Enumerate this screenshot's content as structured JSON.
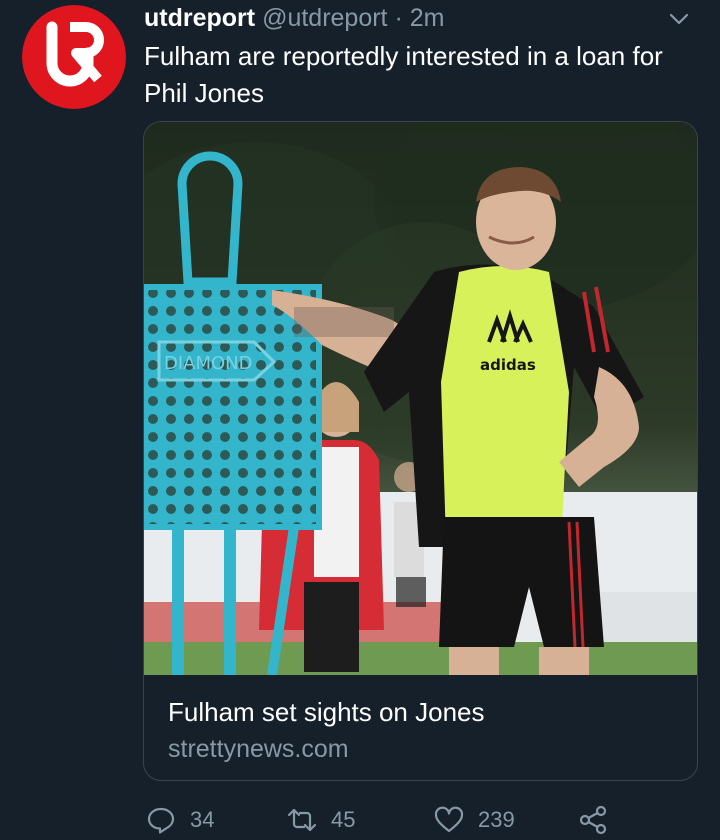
{
  "tweet": {
    "display_name": "utdreport",
    "handle": "@utdreport",
    "separator": "·",
    "time": "2m",
    "text": "Fulham are reportedly interested in a loan for Phil Jones",
    "avatar_icon": "utdreport-logo-icon"
  },
  "card": {
    "title": "Fulham set sights on Jones",
    "domain": "strettynews.com",
    "photo_watermark": "DIAMOND",
    "photo_kit_logo": "adidas"
  },
  "actions": {
    "replies": "34",
    "retweets": "45",
    "likes": "239"
  },
  "colors": {
    "background": "#15202b",
    "text_secondary": "#8899a6",
    "border": "#38444d",
    "logo_red": "#e0161e",
    "bib_green": "#d7f15a",
    "mannequin_blue": "#33b6cc"
  }
}
